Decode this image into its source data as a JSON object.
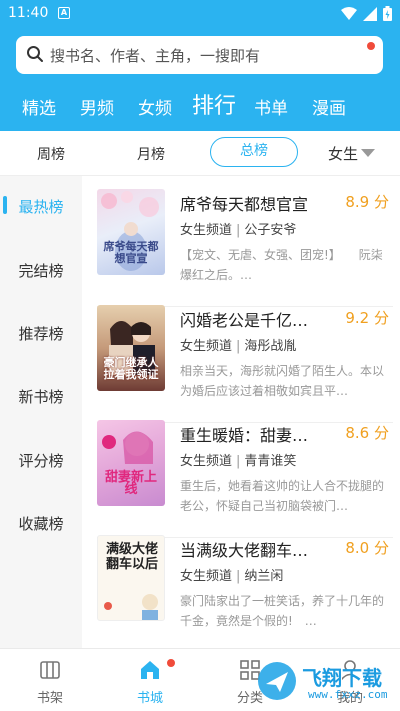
{
  "status": {
    "time": "11:40",
    "a_glyph": "A"
  },
  "search": {
    "placeholder": "搜书名、作者、主角，一搜即有"
  },
  "nav": {
    "items": [
      "精选",
      "男频",
      "女频",
      "排行",
      "书单",
      "漫画"
    ],
    "active": "排行"
  },
  "rank_tabs": {
    "items": [
      "周榜",
      "月榜",
      "总榜"
    ],
    "active": "总榜",
    "gender": "女生"
  },
  "sidebar": {
    "items": [
      "最热榜",
      "完结榜",
      "推荐榜",
      "新书榜",
      "评分榜",
      "收藏榜"
    ],
    "active": "最热榜"
  },
  "books": [
    {
      "title": "席爷每天都想官宣",
      "score": "8.9 分",
      "channel": "女生频道",
      "author": "公子安爷",
      "desc": "【宠文、无虐、女强、团宠!】　　阮柒爆红之后。…",
      "cover_text": "席爷每天都想官宣"
    },
    {
      "title": "闪婚老公是千亿…",
      "score": "9.2 分",
      "channel": "女生频道",
      "author": "海彤战胤",
      "desc": "相亲当天，海彤就闪婚了陌生人。本以为婚后应该过着相敬如宾且平…",
      "cover_text": "豪门继承人拉着我领证"
    },
    {
      "title": "重生暖婚：甜妻…",
      "score": "8.6 分",
      "channel": "女生频道",
      "author": "青青谁笑",
      "desc": "重生后，她看着这帅的让人合不拢腿的老公，怀疑自己当初脑袋被门…",
      "cover_text": "甜妻新上线"
    },
    {
      "title": "当满级大佬翻车…",
      "score": "8.0 分",
      "channel": "女生频道",
      "author": "纳兰闲",
      "desc": "豪门陆家出了一桩笑话，养了十几年的千金，竟然是个假的!　…",
      "cover_text": "满级大佬翻车以后"
    }
  ],
  "bottom_nav": {
    "items": [
      "书架",
      "书城",
      "分类",
      "我的"
    ],
    "active": "书城"
  },
  "watermark": {
    "text": "飞翔下载",
    "url": "www.fxxz.com"
  },
  "colors": {
    "accent": "#2bb3f0",
    "score": "#f0a020",
    "badge": "#f04b3a"
  }
}
